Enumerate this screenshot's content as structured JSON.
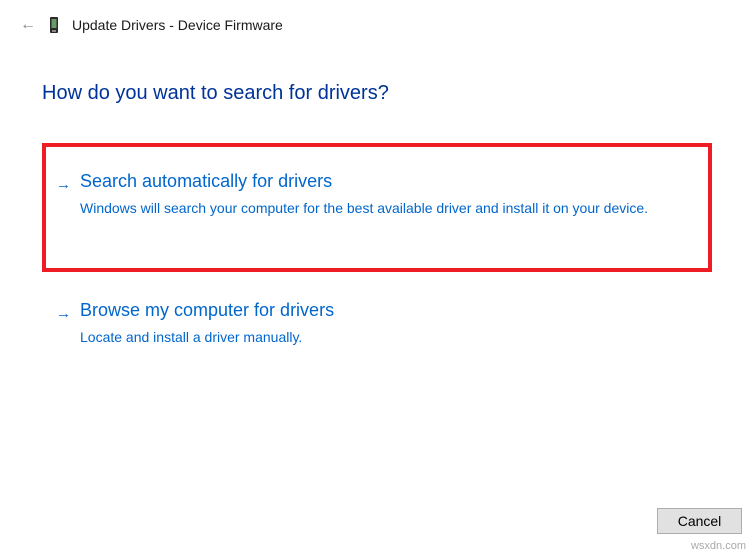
{
  "header": {
    "title": "Update Drivers - Device Firmware"
  },
  "heading": "How do you want to search for drivers?",
  "options": [
    {
      "title": "Search automatically for drivers",
      "description": "Windows will search your computer for the best available driver and install it on your device."
    },
    {
      "title": "Browse my computer for drivers",
      "description": "Locate and install a driver manually."
    }
  ],
  "footer": {
    "cancel_label": "Cancel"
  },
  "watermark": "wsxdn.com"
}
